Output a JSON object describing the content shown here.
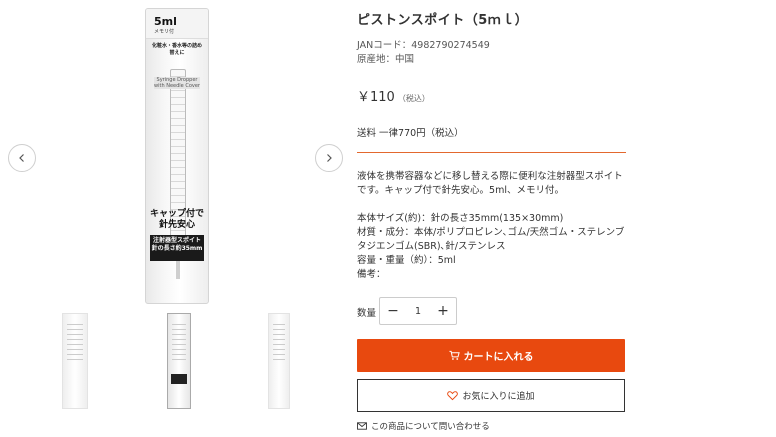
{
  "product": {
    "title": "ピストンスポイト（5ｍｌ）",
    "jan": "JANコード：4982790274549",
    "origin": "原産地：中国",
    "price": "￥110",
    "price_tax": "（税込）",
    "shipping": "送料 一律770円（税込）",
    "description": "液体を携帯容器などに移し替える際に便利な注射器型スポイトです。キャップ付で針先安心。5ml、メモリ付。\n\n本体サイズ(約)：針の長さ35mm(135×30mm)\n材質・成分：本体/ポリプロピレン､ゴム/天然ゴム・ステレンブタジエンゴム(SBR)､針/ステンレス\n容量・重量（約）：5ml\n備考："
  },
  "image": {
    "size": "5ml",
    "sub": "メモリ付",
    "desc": "化粧水・香水等の詰め替えに",
    "syringe_label": "Syringe Dropper with Needle Cover",
    "cap_text": "キャップ付で針先安心",
    "band_text": "注射器型スポイト 針の長さ約35mm"
  },
  "quantity": {
    "label": "数量",
    "value": "1",
    "minus": "−",
    "plus": "+"
  },
  "actions": {
    "cart": "カートに入れる",
    "favorite": "お気に入りに追加",
    "inquiry": "この商品について問い合わせる"
  },
  "colors": {
    "accent": "#e8490f",
    "divider": "#e3682e"
  },
  "icons": {
    "prev": "chevron-left-icon",
    "next": "chevron-right-icon",
    "cart": "cart-icon",
    "heart": "heart-icon",
    "mail": "mail-icon"
  }
}
